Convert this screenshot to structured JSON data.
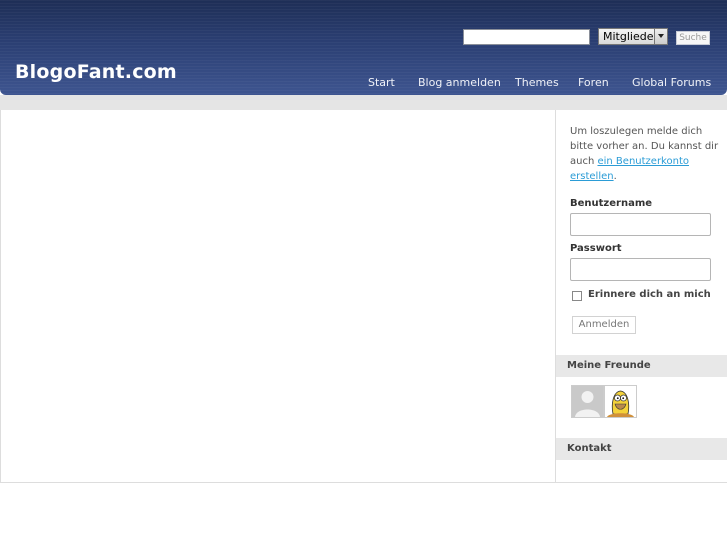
{
  "header": {
    "logo": "BlogoFant.com",
    "search_value": "",
    "search_scope": "Mitglieder",
    "search_button": "Suche",
    "nav": [
      "Start",
      "Blog anmelden",
      "Themes",
      "Foren",
      "Global Forums"
    ]
  },
  "sidebar": {
    "intro_text": "Um loszulegen melde dich bitte vorher an. Du kannst dir auch ",
    "intro_link": "ein Benutzerkonto erstellen",
    "intro_end": ".",
    "username_label": "Benutzername",
    "password_label": "Passwort",
    "remember_label": "Erinnere dich an mich",
    "login_button": "Anmelden",
    "friends_heading": "Meine Freunde",
    "friends": [
      {
        "avatar": "default-person-avatar"
      },
      {
        "avatar": "homer-cartoon-avatar"
      }
    ],
    "contact_heading": "Kontakt"
  }
}
